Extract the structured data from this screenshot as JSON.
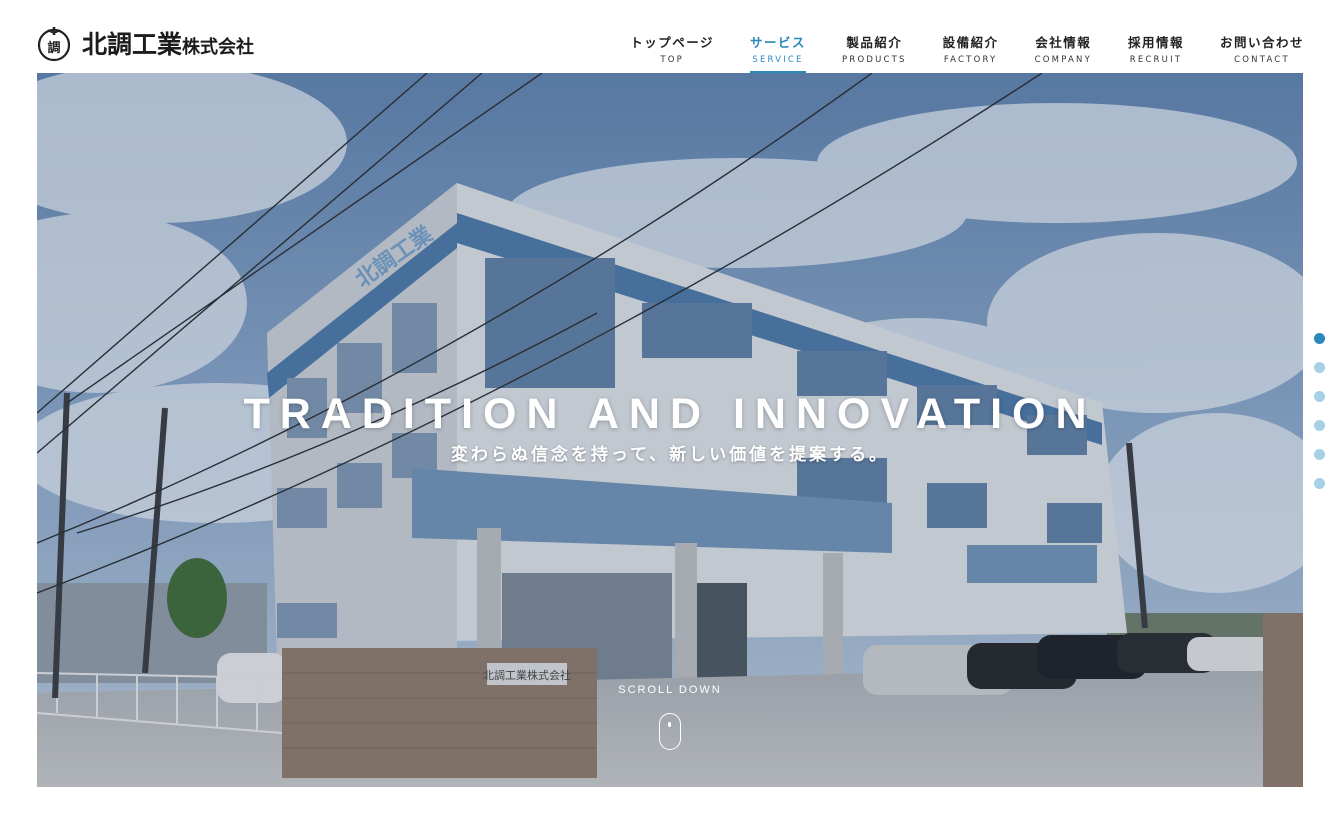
{
  "brand": {
    "logo_mark_text": "調",
    "name_main": "北調工業",
    "name_suffix": "株式会社"
  },
  "nav": {
    "items": [
      {
        "jp": "トップページ",
        "en": "TOP",
        "active": false
      },
      {
        "jp": "サービス",
        "en": "SERVICE",
        "active": true
      },
      {
        "jp": "製品紹介",
        "en": "PRODUCTS",
        "active": false
      },
      {
        "jp": "設備紹介",
        "en": "FACTORY",
        "active": false
      },
      {
        "jp": "会社情報",
        "en": "COMPANY",
        "active": false
      },
      {
        "jp": "採用情報",
        "en": "RECRUIT",
        "active": false
      },
      {
        "jp": "お問い合わせ",
        "en": "CONTACT",
        "active": false
      }
    ],
    "active_color": "#2a88bb"
  },
  "hero": {
    "title": "TRADITION AND INNOVATION",
    "subtitle": "変わらぬ信念を持って、新しい価値を提案する。",
    "building_sign": "北調工業",
    "gate_plate": "北調工業株式会社",
    "scroll_label": "SCROLL DOWN"
  },
  "pager": {
    "count": 6,
    "active_index": 0,
    "active_color": "#2a88bb",
    "inactive_color": "#a5d0e6"
  }
}
